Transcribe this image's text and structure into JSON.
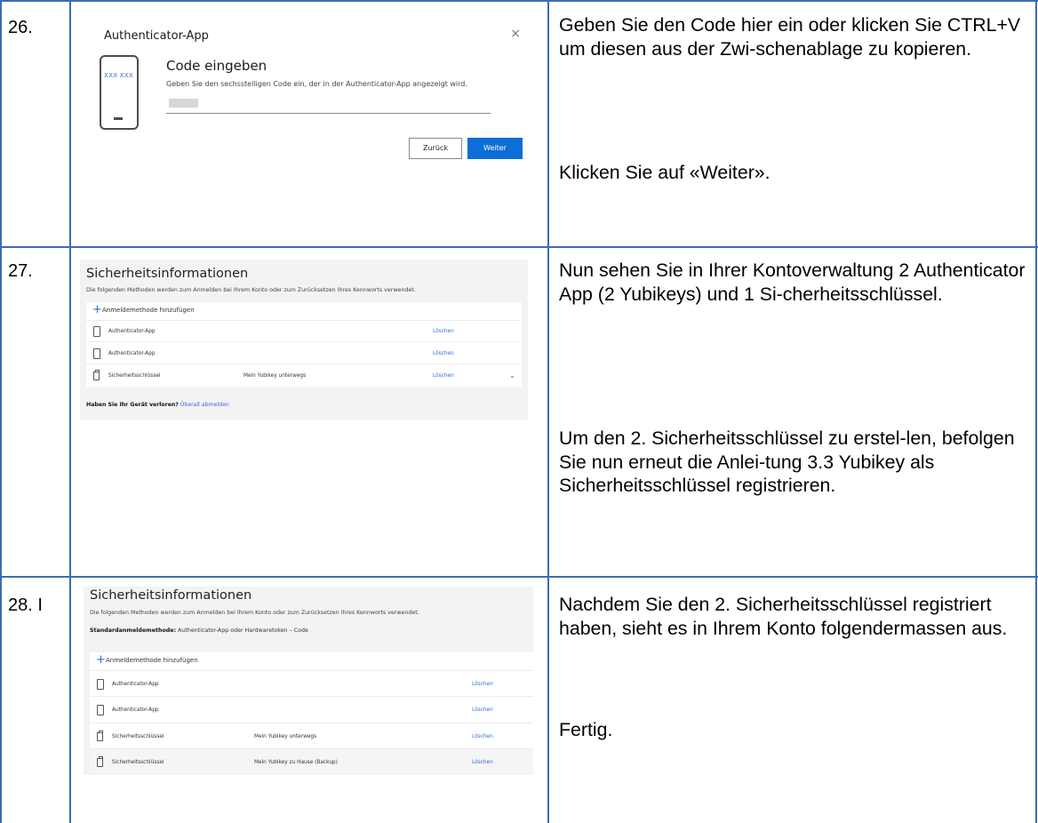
{
  "colors": {
    "table_border": "#3b6db3",
    "primary_button": "#0c6ed6",
    "link": "#2f6fd6",
    "panel_bg": "#f3f3f3"
  },
  "steps": [
    {
      "number": "26.",
      "description": [
        "Geben Sie den Code hier ein oder klicken Sie CTRL+V um diesen aus der Zwi-schenablage zu kopieren.",
        "Klicken Sie auf «Weiter»."
      ]
    },
    {
      "number": "27.",
      "description": [
        "Nun sehen Sie in Ihrer Kontoverwaltung 2 Authenticator App (2 Yubikeys) und 1 Si-cherheitsschlüssel.",
        "Um den 2. Sicherheitsschlüssel zu erstel-len, befolgen Sie nun erneut die Anlei-tung 3.3 Yubikey als Sicherheitsschlüssel registrieren."
      ]
    },
    {
      "number": "28. I",
      "description": [
        "Nachdem Sie den 2. Sicherheitsschlüssel registriert haben, sieht es in Ihrem Konto folgendermassen aus.",
        "Fertig."
      ]
    }
  ],
  "dialog26": {
    "title": "Authenticator-App",
    "close_icon": "×",
    "phone_digits": "XXX XXX",
    "heading": "Code eingeben",
    "instruction": "Geben Sie den sechsstelligen Code ein, der in der Authenticator-App angezeigt wird.",
    "back_label": "Zurück",
    "next_label": "Weiter"
  },
  "security27": {
    "title": "Sicherheitsinformationen",
    "subtitle": "Die folgenden Methoden werden zum Anmelden bei Ihrem Konto oder zum Zurücksetzen Ihres Kennworts verwendet.",
    "add_label": "Anmeldemethode hinzufügen",
    "methods": [
      {
        "icon": "phone-icon",
        "name": "Authenticator-App",
        "detail": "",
        "action": "Löschen"
      },
      {
        "icon": "phone-icon",
        "name": "Authenticator-App",
        "detail": "",
        "action": "Löschen"
      },
      {
        "icon": "security-key-icon",
        "name": "Sicherheitsschlüssel",
        "detail": "Mein Yubikey unterwegs",
        "action": "Löschen"
      }
    ],
    "lost_question": "Haben Sie Ihr Gerät verloren?",
    "lost_link": "Überall abmelden"
  },
  "security28": {
    "title": "Sicherheitsinformationen",
    "subtitle": "Die folgenden Methoden werden zum Anmelden bei Ihrem Konto oder zum Zurücksetzen Ihres Kennworts verwendet.",
    "default_label": "Standardanmeldemethode:",
    "default_value": "Authenticator-App oder Hardwaretoken – Code",
    "add_label": "Anmeldemethode hinzufügen",
    "methods": [
      {
        "icon": "phone-icon",
        "name": "Authenticator-App",
        "detail": "",
        "action": "Löschen"
      },
      {
        "icon": "phone-icon",
        "name": "Authenticator-App",
        "detail": "",
        "action": "Löschen"
      },
      {
        "icon": "security-key-icon",
        "name": "Sicherheitsschlüssel",
        "detail": "Mein Yubikey unterwegs",
        "action": "Löschen"
      },
      {
        "icon": "security-key-icon",
        "name": "Sicherheitsschlüssel",
        "detail": "Mein Yubikey zu Hause (Backup)",
        "action": "Löschen"
      }
    ]
  }
}
